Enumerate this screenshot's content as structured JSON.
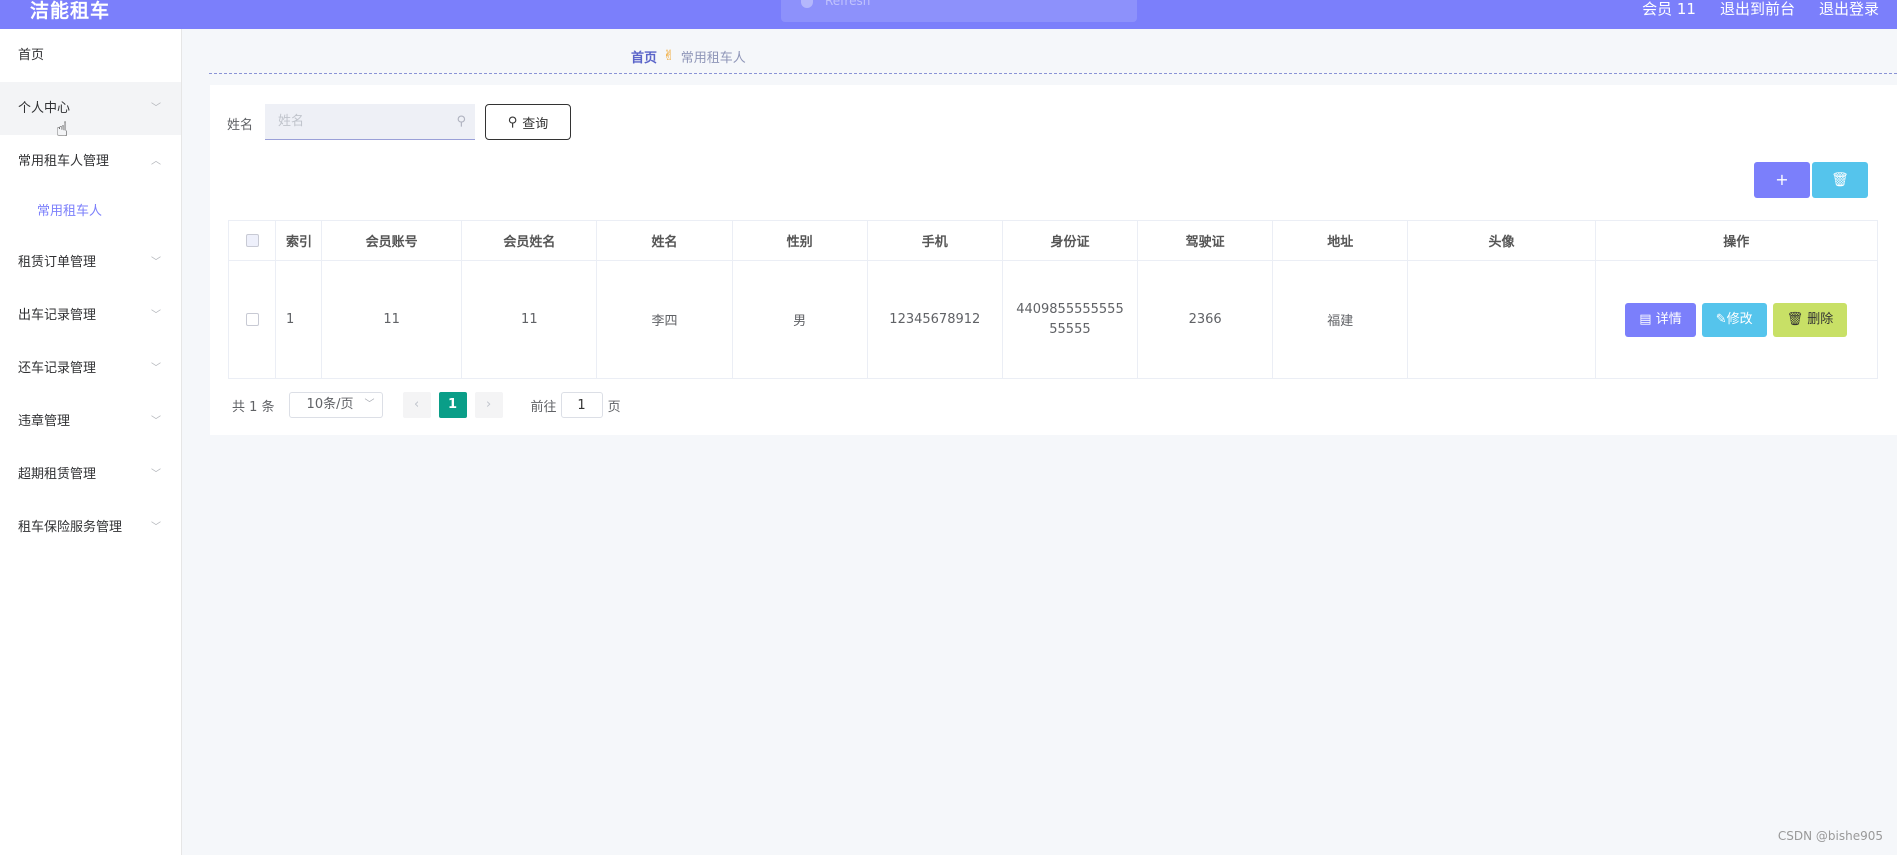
{
  "app": {
    "title": "洁能租车"
  },
  "toast": {
    "text": "Refresh"
  },
  "header": {
    "user_label": "会员 11",
    "back_to_front": "退出到前台",
    "logout": "退出登录"
  },
  "sidebar": {
    "items": [
      {
        "label": "首页"
      },
      {
        "label": "个人中心"
      },
      {
        "label": "常用租车人管理",
        "expanded": true,
        "children": [
          {
            "label": "常用租车人"
          }
        ]
      },
      {
        "label": "租赁订单管理"
      },
      {
        "label": "出车记录管理"
      },
      {
        "label": "还车记录管理"
      },
      {
        "label": "违章管理"
      },
      {
        "label": "超期租赁管理"
      },
      {
        "label": "租车保险服务管理"
      }
    ]
  },
  "breadcrumb": {
    "home": "首页",
    "current": "常用租车人"
  },
  "search": {
    "label": "姓名",
    "placeholder": "姓名",
    "value": "",
    "button": "查询"
  },
  "actions": {
    "add_icon": "plus-icon",
    "delete_icon": "trash-icon"
  },
  "table": {
    "headers": [
      "索引",
      "会员账号",
      "会员姓名",
      "姓名",
      "性别",
      "手机",
      "身份证",
      "驾驶证",
      "地址",
      "头像",
      "操作"
    ],
    "rows": [
      {
        "index": "1",
        "member_account": "11",
        "member_name": "11",
        "name": "李四",
        "gender": "男",
        "phone": "12345678912",
        "id_card": "440985555555555555",
        "driver_license": "2366",
        "address": "福建",
        "ops": {
          "detail": "详情",
          "edit": "修改",
          "delete": "删除"
        }
      }
    ]
  },
  "pagination": {
    "total": "共 1 条",
    "page_size": "10条/页",
    "current_page": "1",
    "goto_label": "前往",
    "goto_value": "1",
    "page_suffix": "页"
  },
  "watermark": "CSDN @bishe905",
  "colors": {
    "primary": "#7b7ffb",
    "info": "#55c4ec",
    "warning": "#c8e066",
    "pager_active": "#0a9e88"
  }
}
